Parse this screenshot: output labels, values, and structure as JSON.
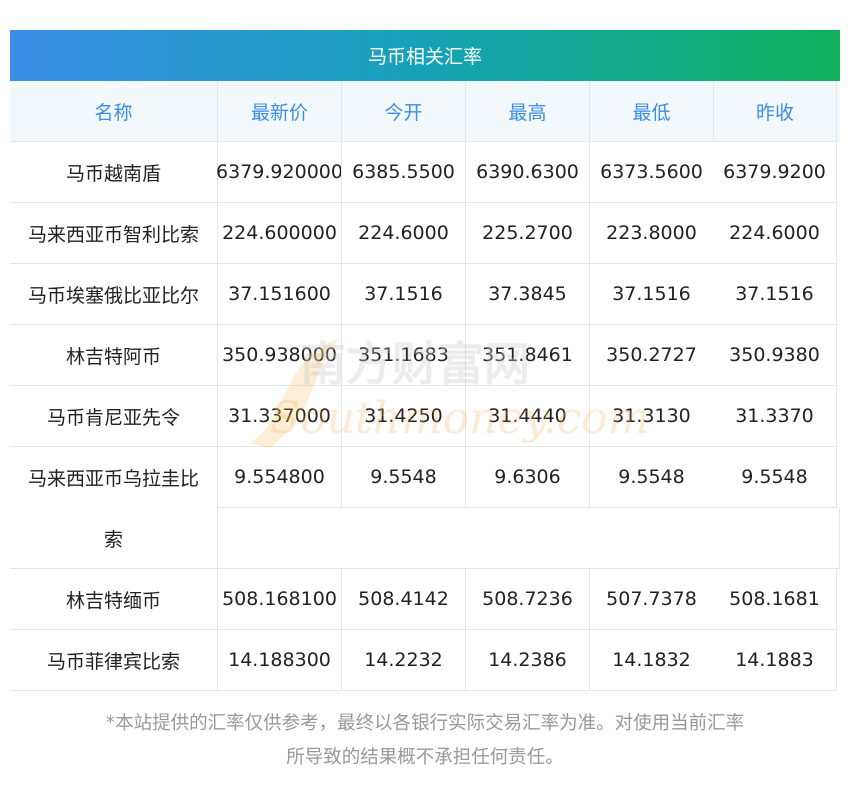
{
  "title": "马币相关汇率",
  "columns": [
    "名称",
    "最新价",
    "今开",
    "最高",
    "最低",
    "昨收"
  ],
  "rows": [
    {
      "name": "马币越南盾",
      "latest": "6379.920000",
      "open": "6385.5500",
      "high": "6390.6300",
      "low": "6373.5600",
      "prev": "6379.9200"
    },
    {
      "name": "马来西亚币智利比索",
      "latest": "224.600000",
      "open": "224.6000",
      "high": "225.2700",
      "low": "223.8000",
      "prev": "224.6000"
    },
    {
      "name": "马币埃塞俄比亚比尔",
      "latest": "37.151600",
      "open": "37.1516",
      "high": "37.3845",
      "low": "37.1516",
      "prev": "37.1516"
    },
    {
      "name": "林吉特阿币",
      "latest": "350.938000",
      "open": "351.1683",
      "high": "351.8461",
      "low": "350.2727",
      "prev": "350.9380"
    },
    {
      "name": "马币肯尼亚先令",
      "latest": "31.337000",
      "open": "31.4250",
      "high": "31.4440",
      "low": "31.3130",
      "prev": "31.3370"
    },
    {
      "name_line1": "马来西亚币乌拉圭比",
      "name_line2": "索",
      "latest": "9.554800",
      "open": "9.5548",
      "high": "9.6306",
      "low": "9.5548",
      "prev": "9.5548"
    },
    {
      "name": "林吉特缅币",
      "latest": "508.168100",
      "open": "508.4142",
      "high": "508.7236",
      "low": "507.7378",
      "prev": "508.1681"
    },
    {
      "name": "马币菲律宾比索",
      "latest": "14.188300",
      "open": "14.2232",
      "high": "14.2386",
      "low": "14.1832",
      "prev": "14.1883"
    }
  ],
  "disclaimer_line1": "*本站提供的汇率仅供参考，最终以各银行实际交易汇率为准。对使用当前汇率",
  "disclaimer_line2": "所导致的结果概不承担任何责任。",
  "watermark": {
    "cn": "南方财富网",
    "en": "Southmoney.com"
  },
  "colors": {
    "header_text": "#3a8ee6",
    "title_grad_start": "#3a8ee6",
    "title_grad_end": "#0fb05a"
  }
}
